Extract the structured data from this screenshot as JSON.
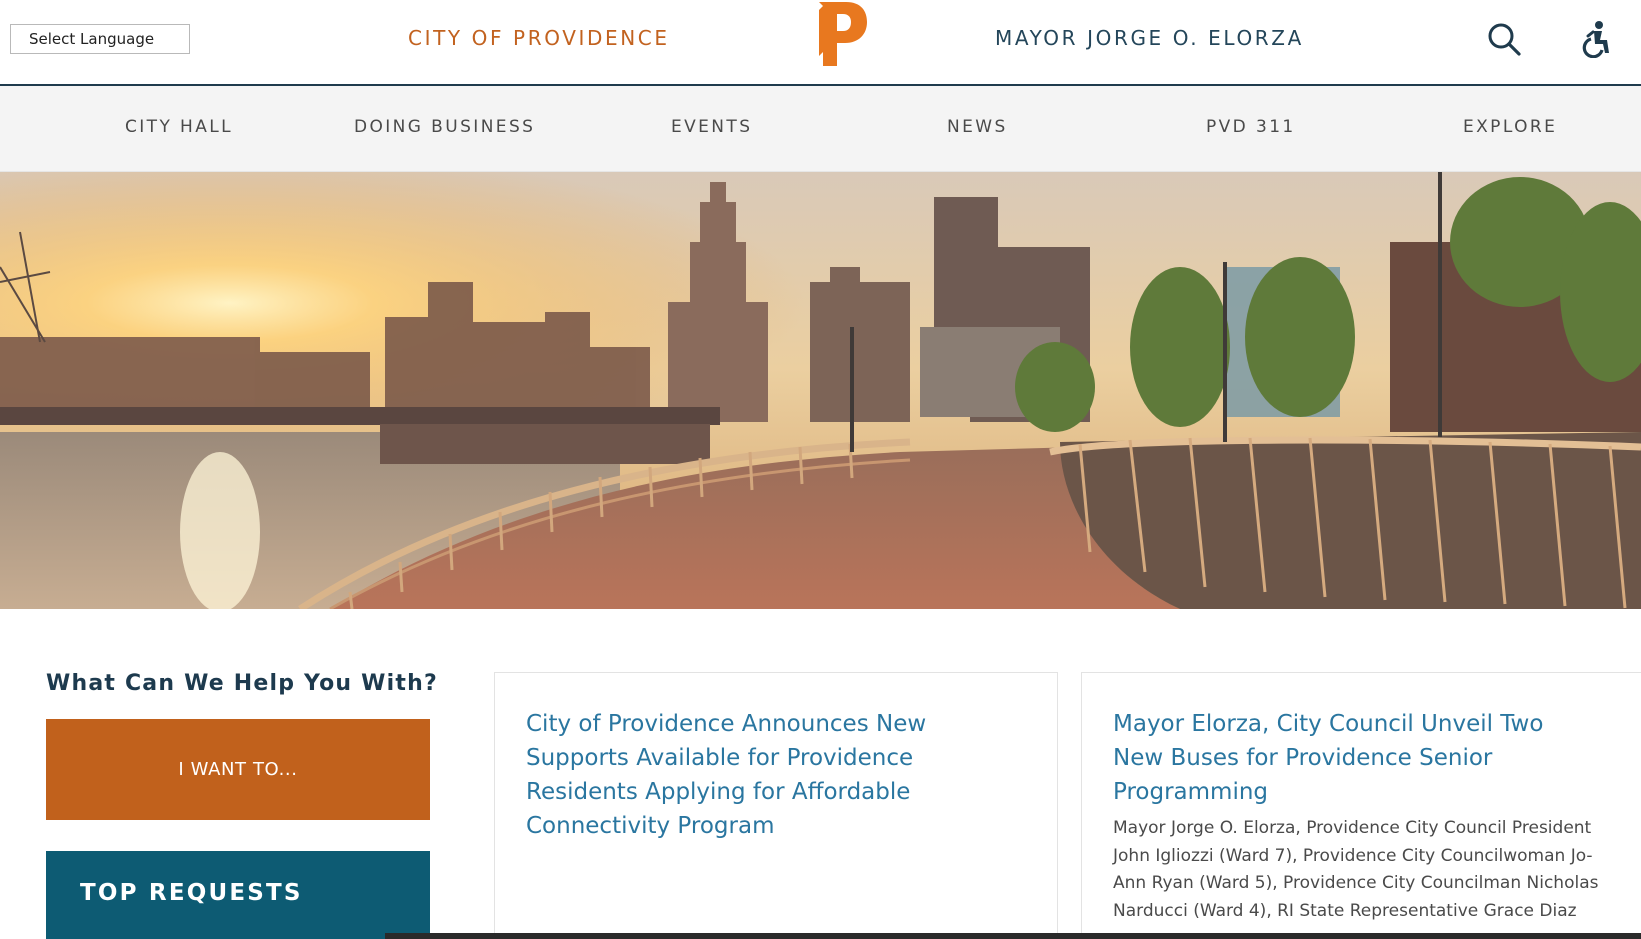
{
  "header": {
    "language_select": "Select Language",
    "site_name": "CITY OF PROVIDENCE",
    "logo_letter": "P",
    "mayor": "MAYOR JORGE O. ELORZA",
    "search_icon": "search-icon",
    "accessibility_icon": "accessibility-icon"
  },
  "nav": {
    "items": [
      "CITY HALL",
      "DOING BUSINESS",
      "EVENTS",
      "NEWS",
      "PVD 311",
      "EXPLORE"
    ]
  },
  "sidebar": {
    "heading": "What Can We Help You With?",
    "i_want_to": "I WANT TO...",
    "top_requests": "TOP REQUESTS"
  },
  "news": [
    {
      "title": "City of Providence Announces New Supports Available for Providence Residents Applying for Affordable Connectivity Program",
      "excerpt": ""
    },
    {
      "title": "Mayor Elorza, City Council Unveil Two New Buses for Providence Senior Programming",
      "excerpt": "Mayor Jorge O. Elorza, Providence City Council President John Igliozzi (Ward 7), Providence City Councilwoman Jo-Ann Ryan (Ward 5), Providence City Councilman Nicholas Narducci (Ward 4), RI State Representative Grace Diaz"
    }
  ],
  "colors": {
    "brand_orange": "#c1611c",
    "brand_teal": "#0d5b73",
    "navy": "#1f3b4d",
    "link_blue": "#2a76a0"
  }
}
